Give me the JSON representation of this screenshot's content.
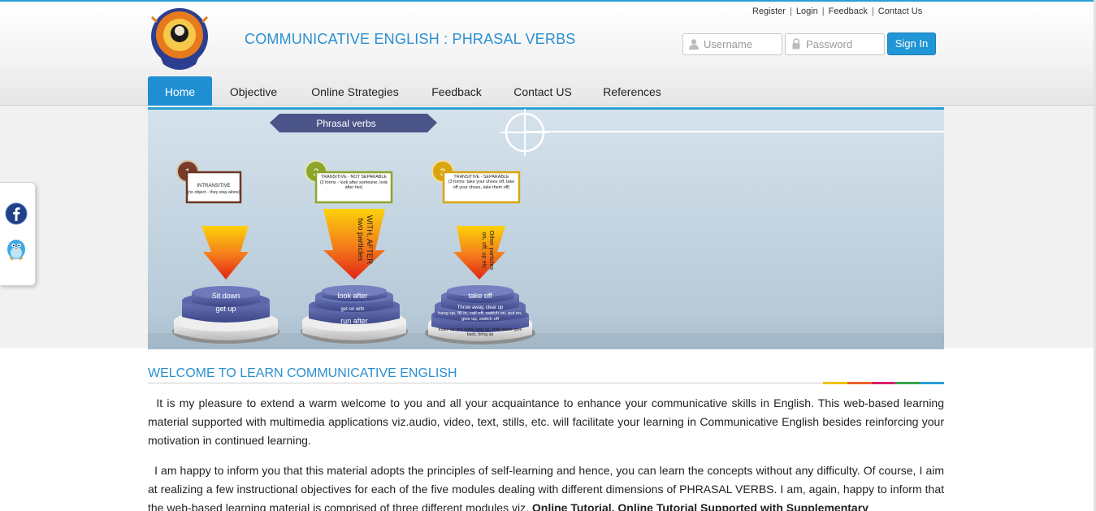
{
  "header": {
    "site_title": "COMMUNICATIVE ENGLISH : PHRASAL VERBS",
    "top_links": [
      {
        "label": "Register"
      },
      {
        "label": "Login"
      },
      {
        "label": "Feedback"
      },
      {
        "label": "Contact Us"
      }
    ],
    "login": {
      "username_placeholder": "Username",
      "password_placeholder": "Password",
      "sign_in_label": "Sign In"
    }
  },
  "nav": {
    "items": [
      {
        "label": "Home",
        "active": true
      },
      {
        "label": "Objective",
        "active": false
      },
      {
        "label": "Online Strategies",
        "active": false
      },
      {
        "label": "Feedback",
        "active": false
      },
      {
        "label": "Contact US",
        "active": false
      },
      {
        "label": "References",
        "active": false
      }
    ]
  },
  "social": {
    "icons": [
      "facebook-icon",
      "twitter-bird-icon"
    ]
  },
  "banner": {
    "heading": "Phrasal verbs",
    "columns": [
      {
        "number": "1",
        "box_title": "INTRANSITIVE",
        "box_text": "(no object - they stay alone)",
        "arrow_text": "",
        "stack": [
          "Sit down",
          "get up"
        ]
      },
      {
        "number": "2",
        "box_title": "TRANSITIVE - NOT SEPARABLE",
        "box_text": "(2 forms - look after someone, look after her)",
        "arrow_text": "WITH, AFTER two particles",
        "stack": [
          "look after",
          "get on with",
          "run after"
        ]
      },
      {
        "number": "3",
        "box_title": "TRANSITIVE - SEPARABLE",
        "box_text": "(3 forms: take your shoes off, take off your shoes, take them off)",
        "arrow_text": "Other particles on, off, up etc",
        "stack": [
          "take off",
          "Throw away, clear up",
          "hang up, fill in, call off, switch on, put on, give up, switch off",
          "make up, put away, look up, write down, give back, bring up"
        ]
      }
    ]
  },
  "content": {
    "welcome_title": "WELCOME TO LEARN COMMUNICATIVE ENGLISH",
    "paragraph1": "It is my pleasure to extend a warm welcome to you and all your acquaintance to enhance your communicative skills in English. This web-based learning material supported with multimedia applications viz.audio, video, text, stills, etc. will facilitate your learning in Communicative English besides reinforcing your motivation in continued learning.",
    "paragraph2_start": "I am happy to inform you that this material adopts the principles of self-learning and hence, you can learn the concepts without any difficulty. Of course, I aim at realizing a few instructional objectives for each of the five modules dealing with different dimensions of PHRASAL VERBS. I am, again, happy to inform that the web-based learning material is comprised of three different modules viz.",
    "paragraph2_bold": "Online Tutorial, Online Tutorial Supported with Supplementary",
    "rainbow_colors": [
      "#f2c200",
      "#e8632b",
      "#d6236b",
      "#3aa64a",
      "#2a9fd6"
    ]
  },
  "colors": {
    "accent": "#1f8fd2",
    "title_blue": "#2a8fd0"
  }
}
